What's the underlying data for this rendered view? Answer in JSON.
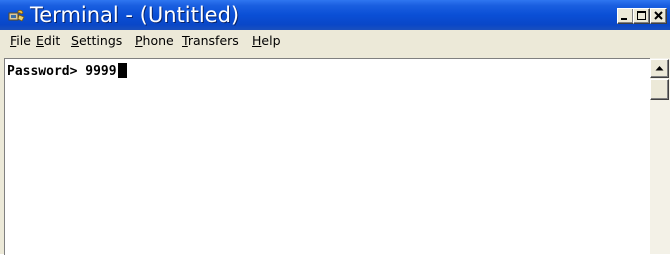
{
  "window": {
    "title": "Terminal - (Untitled)",
    "icon": "hyperterminal-icon"
  },
  "caption_buttons": {
    "minimize_icon": "minimize-icon",
    "maximize_icon": "maximize-icon",
    "close_icon": "close-icon"
  },
  "menu": {
    "items": [
      {
        "accel": "F",
        "rest": "ile"
      },
      {
        "accel": "E",
        "rest": "dit"
      },
      {
        "accel": "S",
        "rest": "ettings"
      },
      {
        "accel": "P",
        "rest": "hone"
      },
      {
        "accel": "T",
        "rest": "ransfers"
      },
      {
        "accel": "H",
        "rest": "elp"
      }
    ]
  },
  "terminal": {
    "prompt": "Password> ",
    "input": "9999"
  }
}
